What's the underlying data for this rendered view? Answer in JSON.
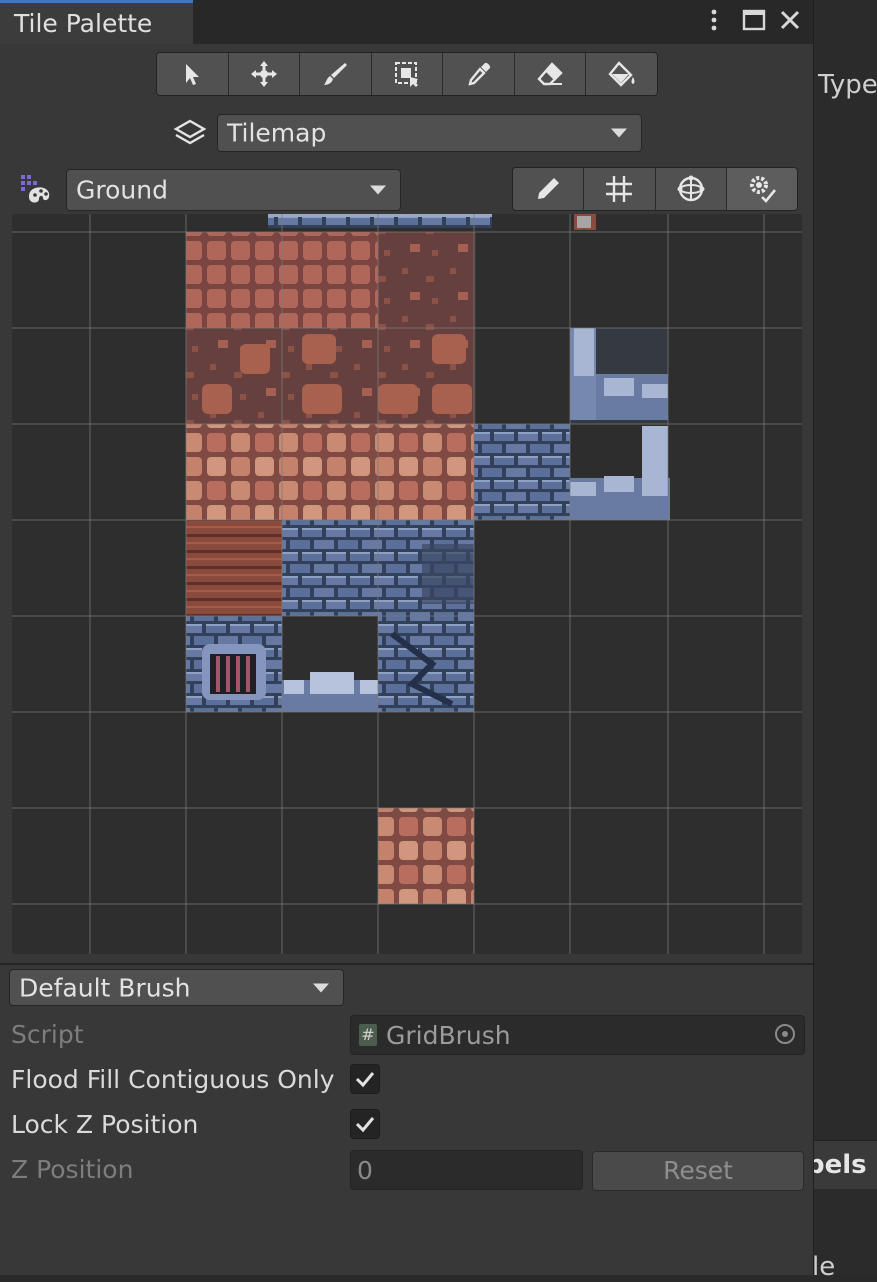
{
  "window": {
    "title": "Tile Palette"
  },
  "background": {
    "type_text": "Type",
    "labels_text": "pels",
    "bottom_text": "le"
  },
  "toolbar": {
    "tools": [
      "select-tool",
      "move-tool",
      "paint-tool",
      "box-fill-tool",
      "picker-tool",
      "erase-tool",
      "flood-fill-tool"
    ]
  },
  "active_tilemap": {
    "selected": "Tilemap"
  },
  "palette_select": {
    "selected": "Ground"
  },
  "view_tools": [
    "edit-palette",
    "grid-toggle",
    "gizmo-toggle",
    "palette-settings"
  ],
  "brush": {
    "selected": "Default Brush",
    "script_label": "Script",
    "script_value": "GridBrush",
    "flood_fill_label": "Flood Fill Contiguous Only",
    "flood_fill_checked": true,
    "lock_z_label": "Lock Z Position",
    "lock_z_checked": true,
    "z_position_label": "Z Position",
    "z_position_value": "0",
    "reset_label": "Reset"
  },
  "colors": {
    "accent": "#3a79bb",
    "brick_red": "#8a4f44",
    "stone_blue": "#4a5f86",
    "light_stone": "#9aa8c7"
  }
}
